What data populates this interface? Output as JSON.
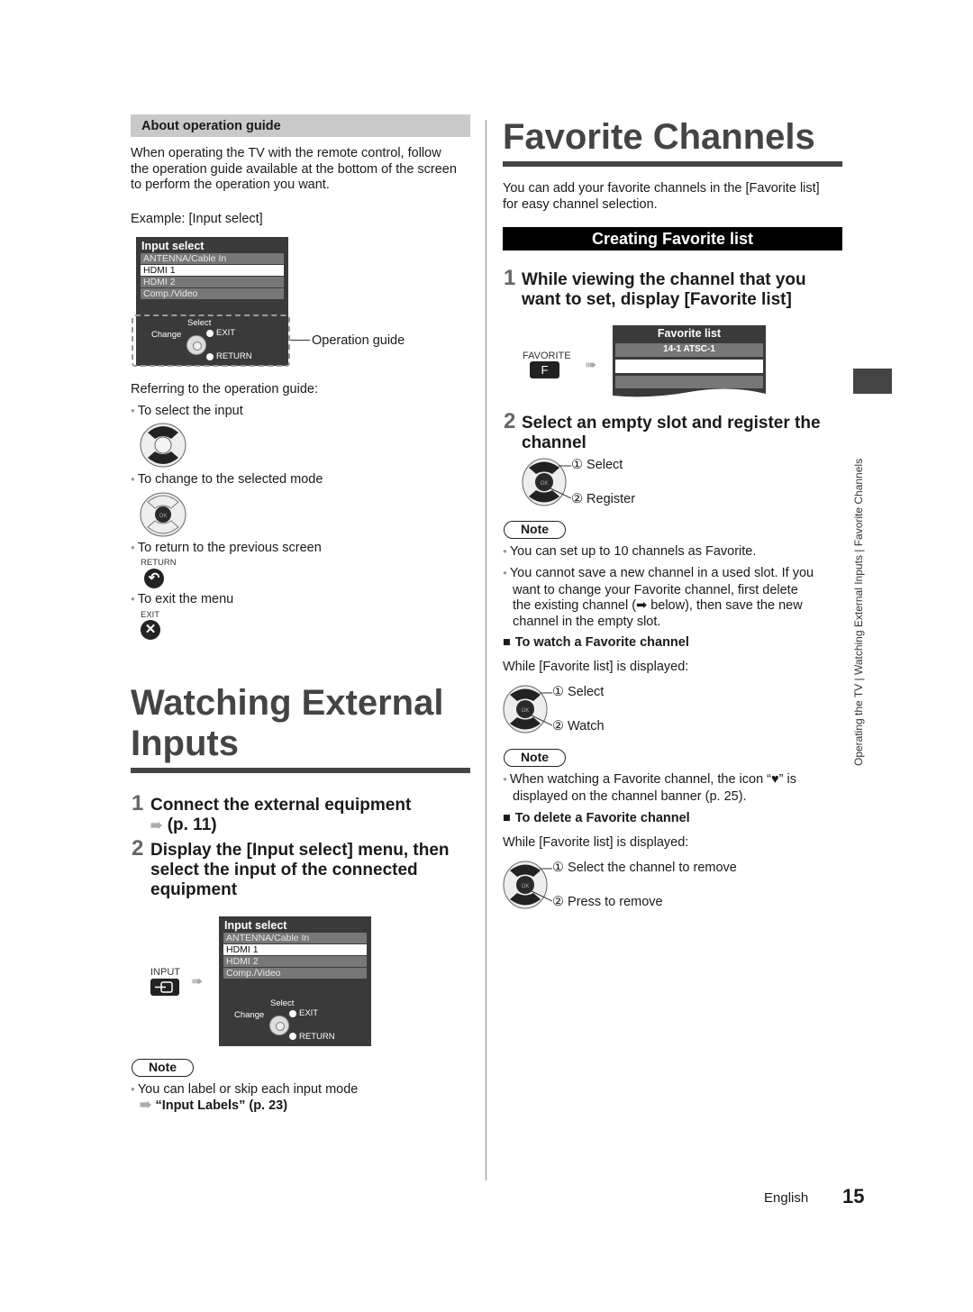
{
  "left": {
    "section_bar": "About operation guide",
    "intro": [
      "When operating the TV with the remote control, follow",
      "the operation guide available at the bottom of the screen",
      "to perform the operation you want."
    ],
    "example_label": "Example: [Input select]",
    "osd": {
      "title": "Input select",
      "rows": [
        "ANTENNA/Cable In",
        "HDMI 1",
        "HDMI 2",
        "Comp./Video"
      ],
      "selected_index": 1,
      "guide": {
        "select": "Select",
        "change": "Change",
        "exit": "EXIT",
        "return": "RETURN"
      }
    },
    "operation_guide_callout": "Operation guide",
    "referring": "Referring to the operation guide:",
    "bullets": [
      {
        "text": "To select the input",
        "icon": "dpad-up-down-icon"
      },
      {
        "text": "To change to the selected mode",
        "icon": "dpad-ok-icon"
      },
      {
        "text": "To return to the previous screen",
        "key_label": "RETURN",
        "icon": "return-button-icon",
        "glyph": "↶"
      },
      {
        "text": "To exit the menu",
        "key_label": "EXIT",
        "icon": "exit-button-icon",
        "glyph": "✕"
      }
    ],
    "chapter_title_line1": "Watching External",
    "chapter_title_line2": "Inputs",
    "steps": [
      {
        "num": "1",
        "lines": [
          "Connect the external equipment",
          "(p. 11)"
        ]
      },
      {
        "num": "2",
        "lines": [
          "Display the [Input select] menu, then",
          "select the input of the connected",
          "equipment"
        ]
      }
    ],
    "input_key_label": "INPUT",
    "osd2": {
      "title": "Input select",
      "rows": [
        "ANTENNA/Cable In",
        "HDMI 1",
        "HDMI 2",
        "Comp./Video"
      ],
      "guide": {
        "select": "Select",
        "change": "Change",
        "exit": "EXIT",
        "return": "RETURN"
      }
    },
    "note_label": "Note",
    "note_text": "You can label or skip each input mode",
    "note_link": "“Input Labels” (p. 23)"
  },
  "right": {
    "chapter_title": "Favorite Channels",
    "intro": [
      "You can add your favorite channels in the [Favorite list]",
      "for easy channel selection."
    ],
    "black_bar": "Creating Favorite list",
    "step1": {
      "num": "1",
      "lines": [
        "While viewing the channel that you",
        "want to set, display [Favorite list]"
      ]
    },
    "favorite_key_label": "FAVORITE",
    "favorite_key_glyph": "F",
    "fav_osd": {
      "title": "Favorite list",
      "row1": "14-1 ATSC-1"
    },
    "step2": {
      "num": "2",
      "lines": [
        "Select an empty slot and register the",
        "channel"
      ]
    },
    "step2_actions": [
      "① Select",
      "② Register"
    ],
    "note_label": "Note",
    "notes": [
      [
        "You can set up to 10 channels as Favorite."
      ],
      [
        "You cannot save a new channel in a used slot. If you",
        "want to change your Favorite channel, first delete",
        "the existing channel (➡ below), then save the new",
        "channel in the empty slot."
      ]
    ],
    "watch_heading": "To watch a Favorite channel",
    "watch_while": "While [Favorite list] is displayed:",
    "watch_actions": [
      "① Select",
      "② Watch"
    ],
    "note2_label": "Note",
    "note2": [
      "When watching a Favorite channel, the icon “♥” is",
      "displayed on the channel banner (p. 25)."
    ],
    "delete_heading": "To delete a Favorite channel",
    "delete_while": "While [Favorite list] is displayed:",
    "delete_actions": [
      "① Select the channel to remove",
      "② Press to remove"
    ]
  },
  "side_text": "Operating the TV  |  Watching External Inputs  |  Favorite Channels",
  "footer": {
    "language": "English",
    "page": "15"
  }
}
